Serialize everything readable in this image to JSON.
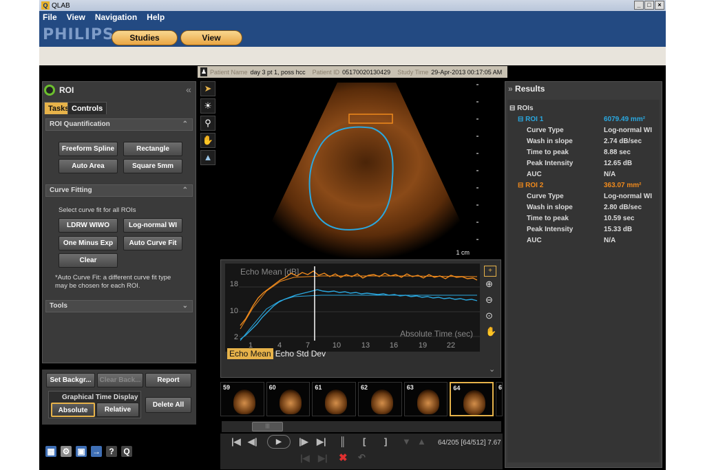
{
  "window": {
    "title": "QLAB",
    "controls": [
      "_",
      "□",
      "×"
    ]
  },
  "menu": [
    "File",
    "View",
    "Navigation",
    "Help"
  ],
  "brand": "PHILIPS",
  "tabs": {
    "studies": "Studies",
    "view": "View"
  },
  "patient": {
    "name_label": "Patient Name",
    "name": "day 3 pt 1, poss hcc",
    "id_label": "Patient ID",
    "id": "05170020130429",
    "time_label": "Study Time",
    "time": "29-Apr-2013 00:17:05 AM"
  },
  "roi_panel": {
    "title": "ROI",
    "tab_tasks": "Tasks",
    "tab_controls": "Controls",
    "quant": {
      "title": "ROI Quantification",
      "buttons": [
        "Freeform Spline",
        "Rectangle",
        "Auto Area",
        "Square 5mm"
      ]
    },
    "curve": {
      "title": "Curve Fitting",
      "instruction": "Select curve fit for all ROIs",
      "buttons": [
        "LDRW WIWO",
        "Log-normal WI",
        "One Minus Exp",
        "Auto Curve Fit",
        "Clear"
      ],
      "note1": "*Auto Curve Fit: a different curve fit type",
      "note2": "may be chosen for each ROI."
    },
    "tools": {
      "title": "Tools"
    }
  },
  "bottom": {
    "set_bg": "Set Backgr...",
    "clear_bg": "Clear Back...",
    "report": "Report",
    "gtd_title": "Graphical Time Display",
    "absolute": "Absolute",
    "relative": "Relative",
    "delete_all": "Delete All"
  },
  "image": {
    "scale_label": "1 cm"
  },
  "graph": {
    "title": "Echo Mean [dB]",
    "x_label": "Absolute Time (sec)",
    "y_ticks": [
      "18",
      "10",
      "2"
    ],
    "x_ticks": [
      "1",
      "4",
      "7",
      "10",
      "13",
      "16",
      "19",
      "22"
    ],
    "tab_mean": "Echo Mean",
    "tab_std": "Echo Std Dev",
    "colors": {
      "roi1": "#2aa8e0",
      "roi2": "#f08a1c"
    }
  },
  "thumbs": [
    "59",
    "60",
    "61",
    "62",
    "63",
    "64",
    "6"
  ],
  "playback": {
    "frame_info": "64/205 [64/512] 7.67"
  },
  "results": {
    "title": "Results",
    "group": "ROIs",
    "roi1": {
      "name": "ROI 1",
      "area": "6079.49 mm²",
      "rows": [
        [
          "Curve Type",
          "Log-normal WI"
        ],
        [
          "Wash in slope",
          "2.74 dB/sec"
        ],
        [
          "Time to peak",
          "8.88 sec"
        ],
        [
          "Peak Intensity",
          "12.65 dB"
        ],
        [
          "AUC",
          "N/A"
        ]
      ]
    },
    "roi2": {
      "name": "ROI 2",
      "area": "363.07 mm²",
      "rows": [
        [
          "Curve Type",
          "Log-normal WI"
        ],
        [
          "Wash in slope",
          "2.80 dB/sec"
        ],
        [
          "Time to peak",
          "10.59 sec"
        ],
        [
          "Peak Intensity",
          "15.33 dB"
        ],
        [
          "AUC",
          "N/A"
        ]
      ]
    }
  }
}
